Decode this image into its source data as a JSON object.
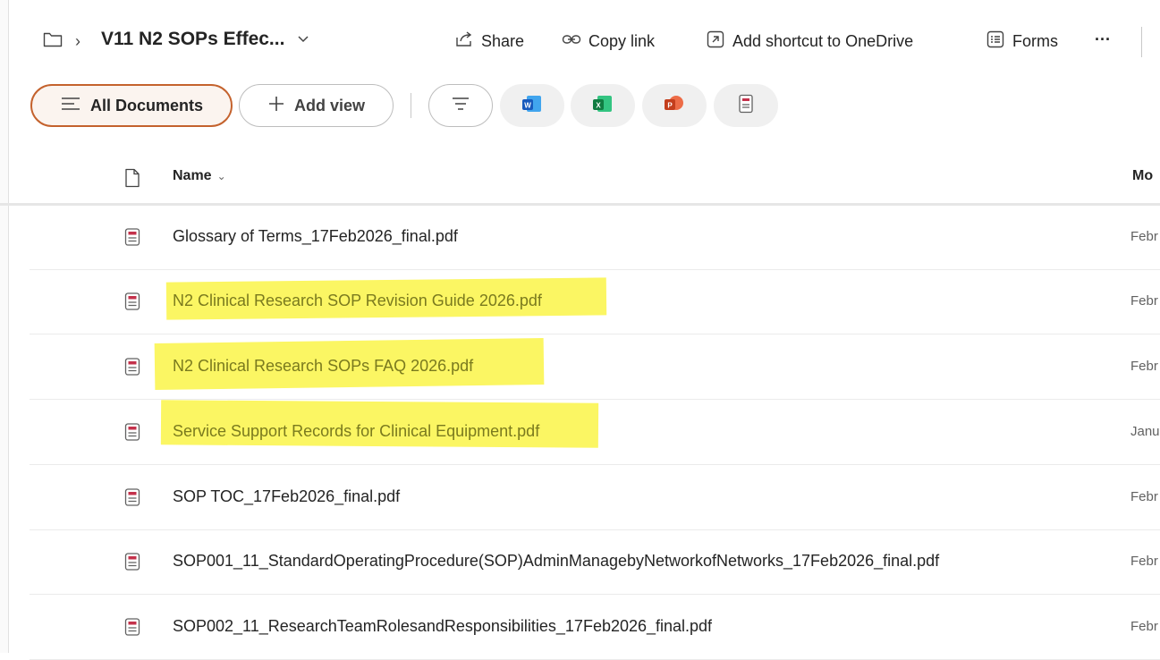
{
  "breadcrumb": {
    "title": "V11 N2 SOPs Effec..."
  },
  "commands": {
    "share": "Share",
    "copy_link": "Copy link",
    "add_shortcut": "Add shortcut to OneDrive",
    "forms": "Forms",
    "more": "···"
  },
  "views": {
    "all_documents": "All Documents",
    "add_view": "Add view"
  },
  "list": {
    "header_name": "Name",
    "header_modified": "Mo",
    "rows": [
      {
        "name": "Glossary of Terms_17Feb2026_final.pdf",
        "modified": "Febr",
        "highlighted": false
      },
      {
        "name": "N2 Clinical Research SOP Revision Guide 2026.pdf",
        "modified": "Febr",
        "highlighted": true
      },
      {
        "name": "N2 Clinical Research SOPs FAQ 2026.pdf",
        "modified": "Febr",
        "highlighted": true
      },
      {
        "name": "Service Support Records for Clinical Equipment.pdf",
        "modified": "Janu",
        "highlighted": true
      },
      {
        "name": "SOP TOC_17Feb2026_final.pdf",
        "modified": "Febr",
        "highlighted": false
      },
      {
        "name": "SOP001_11_StandardOperatingProcedure(SOP)AdminManagebyNetworkofNetworks_17Feb2026_final.pdf",
        "modified": "Febr",
        "highlighted": false
      },
      {
        "name": "SOP002_11_ResearchTeamRolesandResponsibilities_17Feb2026_final.pdf",
        "modified": "Febr",
        "highlighted": false
      }
    ]
  },
  "colors": {
    "highlight": "#fbf552",
    "selected_view_border": "#c4622d",
    "word": "#185abd",
    "excel": "#107c41",
    "powerpoint": "#c43e1c",
    "pdf": "#c4314b"
  }
}
